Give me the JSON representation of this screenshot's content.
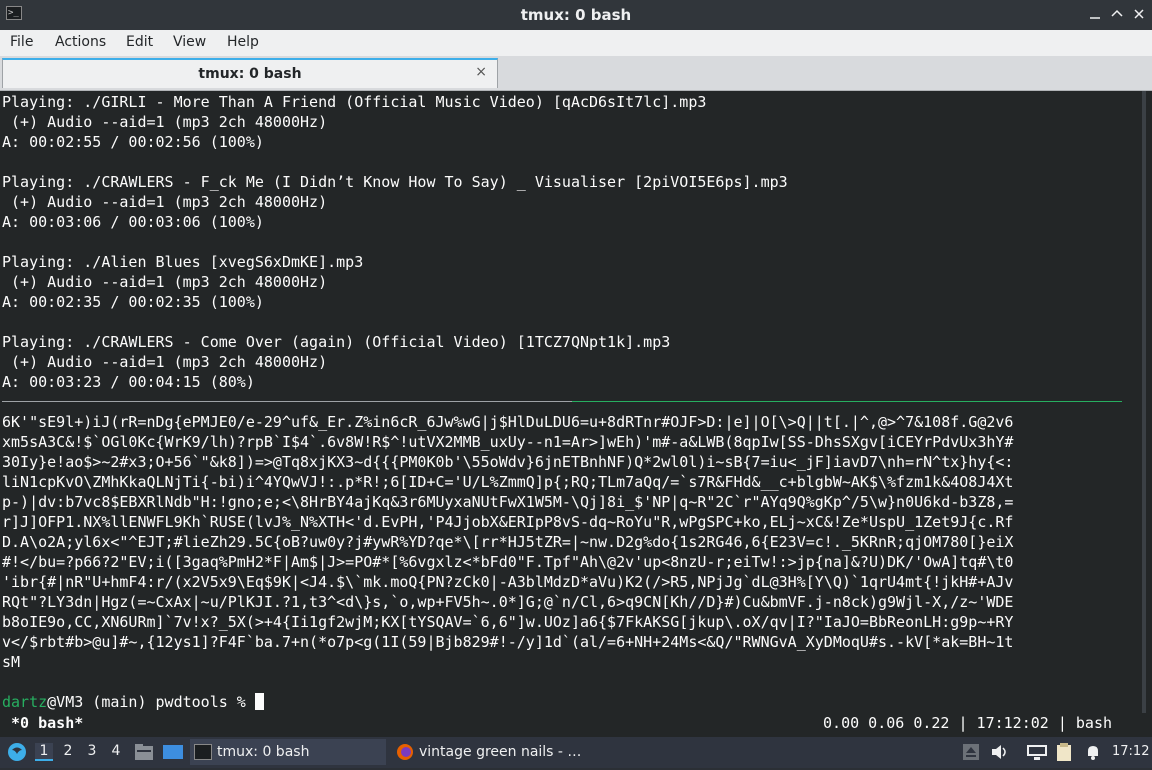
{
  "window": {
    "title": "tmux: 0 bash",
    "minimize_icon": "minimize-icon",
    "maximize_icon": "maximize-icon",
    "close_icon": "close-icon",
    "app_icon": "terminal-icon",
    "app_icon_glyph": ">_"
  },
  "menu": [
    "File",
    "Actions",
    "Edit",
    "View",
    "Help"
  ],
  "tab": {
    "label": "tmux: 0 bash",
    "close": "×"
  },
  "terminal_output": [
    "Playing: ./GIRLI - More Than A Friend (Official Music Video) [qAcD6sIt7lc].mp3",
    " (+) Audio --aid=1 (mp3 2ch 48000Hz)",
    "A: 00:02:55 / 00:02:56 (100%)",
    "",
    "Playing: ./CRAWLERS - F_ck Me (I Didn’t Know How To Say) _ Visualiser [2piVOI5E6ps].mp3",
    " (+) Audio --aid=1 (mp3 2ch 48000Hz)",
    "A: 00:03:06 / 00:03:06 (100%)",
    "",
    "Playing: ./Alien Blues [xvegS6xDmKE].mp3",
    " (+) Audio --aid=1 (mp3 2ch 48000Hz)",
    "A: 00:02:35 / 00:02:35 (100%)",
    "",
    "Playing: ./CRAWLERS - Come Over (again) (Official Video) [1TCZ7QNpt1k].mp3",
    " (+) Audio --aid=1 (mp3 2ch 48000Hz)",
    "A: 00:03:23 / 00:04:15 (80%)"
  ],
  "random_output": [
    "6K'\"sE9l+)iJ(rR=nDg{ePMJE0/e-29^uf&_Er.Z%in6cR_6Jw%wG|j$HlDuLDU6=u+8dRTnr#OJF>D:|e]|O[\\>Q||t[.|^,@>^7&108f.G@2v6",
    "xm5sA3C&!$`OGl0Kc{WrK9/lh)?rpB`I$4`.6v8W!R$^!utVX2MMB_uxUy--n1=Ar>]wEh)'m#-a&LWB(8qpIw[SS-DhsSXgv[iCEYrPdvUx3hY#",
    "30Iy}e!ao$>~2#x3;O+56`\"&k8])=>@Tq8xjKX3~d{{{PM0K0b'\\55oWdv}6jnETBnhNF)Q*2wl0l)i~sB{7=iu<_jF]iavD7\\nh=rN^tx}hy{<:",
    "liN1cpKvO\\ZMhKkaQLNjTi{-bi)i^4YQwVJ!:.p*R!;6[ID+C='U/L%ZmmQ]p{;RQ;TLm7aQq/=`s7R&FHd&__c+blgbW~AK$\\%fzm1k&4O8J4Xt",
    "p-)|dv:b7vc8$EBXRlNdb\"H:!gno;e;<\\8HrBY4ajKq&3r6MUyxaNUtFwX1W5M-\\Qj]8i_$'NP|q~R\"2C`r\"AYq9Q%gKp^/5\\w}n0U6kd-b3Z8,=",
    "r]J]OFP1.NX%llENWFL9Kh`RUSE(lvJ%_N%XTH<'d.EvPH,'P4JjobX&ERIpP8vS-dq~RoYu\"R,wPgSPC+ko,ELj~xC&!Ze*UspU_1Zet9J{c.Rf",
    "D.A\\o2A;yl6x<\"^EJT;#lieZh29.5C{oB?uw0y?j#ywR%YD?qe*\\[rr*HJ5tZR=|~nw.D2g%do{1s2RG46,6{E23V=c!._5KRnR;qjOM780[}eiX",
    "#!</bu=?p66?2\"EV;i([3gaq%PmH2*F|Am$|J>=PO#*[%6vgxlz<*bFd0\"F.Tpf\"Ah\\@2v'up<8nzU-r;eiTw!:>jp{na]&?U)DK/'OwA]tq#\\t0",
    "'ibr{#|nR\"U+hmF4:r/(x2V5x9\\Eq$9K|<J4.$\\`mk.moQ{PN?zCk0|-A3blMdzD*aVu)K2(/>R5,NPjJg`dL@3H%[Y\\Q)`1qrU4mt{!jkH#+AJv",
    "RQt\"?LY3dn|Hgz(=~CxAx|~u/PlKJI.?1,t3^<d\\}s,`o,wp+FV5h~.0*]G;@`n/Cl,6>q9CN[Kh//D}#)Cu&bmVF.j-n8ck)g9Wjl-X,/z~'WDE",
    "b8oIE9o,CC,XN6URm]`7v!x?_5X(>+4{Ii1gf2wjM;KX[tYSQAV=`6,6\"]w.UOz]a6{$7FkAKSG[jkup\\.oX/qv|I?\"IaJO=BbReonLH:g9p~+RY",
    "v</$rbt#b>@u]#~,{12ys1]?F4F`ba.7+n(*o7p<g(1I(59|Bjb829#!-/y]1d`(al/=6+NH+24Ms<&Q/\"RWNGvA_XyDMoqU#s.-kV[*ak=BH~1t",
    "sM"
  ],
  "prompt": {
    "user": "dartz",
    "rest": "@VM3 (main) pwdtools % "
  },
  "status": {
    "left": " *0 bash*",
    "right": "0.00 0.06 0.22 | 17:12:02 | bash"
  },
  "taskbar": {
    "start_icon": "start-menu-icon",
    "workspaces": [
      "1",
      "2",
      "3",
      "4"
    ],
    "active_workspace": "1",
    "launchers": [
      "file-manager-icon",
      "desktop-icon"
    ],
    "tasks": [
      {
        "icon": "terminal-icon",
        "label": "tmux: 0 bash"
      },
      {
        "icon": "firefox-icon",
        "label": "vintage green nails - …"
      }
    ],
    "tray": [
      "eject-icon",
      "volume-icon",
      "network-icon",
      "clipboard-icon",
      "notification-icon"
    ],
    "clock": "17:12"
  },
  "colors": {
    "accent": "#3daee9",
    "prompt_user": "#27ae60",
    "terminal_bg": "#232627"
  }
}
